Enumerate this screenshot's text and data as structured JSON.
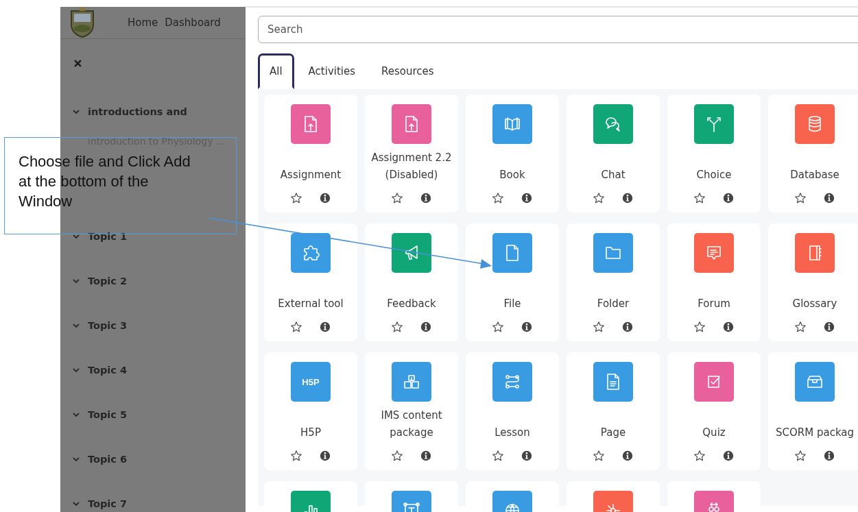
{
  "header": {
    "nav": [
      "Home",
      "Dashboard"
    ]
  },
  "sidebar": {
    "sections": [
      {
        "title": "introductions and",
        "subtitle": "introduction to Physiology ...",
        "expanded": true
      },
      {
        "title": "Topic 1",
        "expanded": true
      },
      {
        "title": "Topic 2",
        "expanded": true
      },
      {
        "title": "Topic 3",
        "expanded": true
      },
      {
        "title": "Topic 4",
        "expanded": true
      },
      {
        "title": "Topic 5",
        "expanded": true
      },
      {
        "title": "Topic 6",
        "expanded": true
      },
      {
        "title": "Topic 7",
        "expanded": true
      }
    ]
  },
  "chooser": {
    "search": {
      "placeholder": "Search"
    },
    "tabs": [
      {
        "label": "All",
        "selected": true
      },
      {
        "label": "Activities",
        "selected": false
      },
      {
        "label": "Resources",
        "selected": false
      }
    ],
    "modules": [
      {
        "label": "Assignment",
        "kind": "upload",
        "color": "#e8609c"
      },
      {
        "label": "Assignment 2.2 (Disabled)",
        "kind": "upload",
        "color": "#e8609c"
      },
      {
        "label": "Book",
        "kind": "book",
        "color": "#399be2"
      },
      {
        "label": "Chat",
        "kind": "chat",
        "color": "#11a676"
      },
      {
        "label": "Choice",
        "kind": "choice",
        "color": "#11a676"
      },
      {
        "label": "Database",
        "kind": "database",
        "color": "#f7634d"
      },
      {
        "label": "External tool",
        "kind": "puzzle",
        "color": "#399be2"
      },
      {
        "label": "Feedback",
        "kind": "megaphone",
        "color": "#11a676"
      },
      {
        "label": "File",
        "kind": "file",
        "color": "#399be2"
      },
      {
        "label": "Folder",
        "kind": "folder",
        "color": "#399be2"
      },
      {
        "label": "Forum",
        "kind": "forum",
        "color": "#f7634d"
      },
      {
        "label": "Glossary",
        "kind": "glossary",
        "color": "#f7634d"
      },
      {
        "label": "H5P",
        "kind": "h5p",
        "icon_text": "H5P",
        "color": "#399be2"
      },
      {
        "label": "IMS content package",
        "kind": "package",
        "color": "#399be2"
      },
      {
        "label": "Lesson",
        "kind": "lesson",
        "color": "#399be2"
      },
      {
        "label": "Page",
        "kind": "page",
        "color": "#399be2"
      },
      {
        "label": "Quiz",
        "kind": "quiz",
        "color": "#e8609c"
      },
      {
        "label": "SCORM packag",
        "kind": "scorm",
        "color": "#399be2"
      },
      {
        "kind": "chart",
        "color": "#11a676"
      },
      {
        "kind": "textframe",
        "color": "#399be2"
      },
      {
        "kind": "globe",
        "color": "#399be2"
      },
      {
        "kind": "network",
        "color": "#f7634d"
      },
      {
        "kind": "people",
        "color": "#e8609c"
      }
    ]
  },
  "callout": {
    "text": "Choose file and Click Add at the bottom of the Window"
  }
}
